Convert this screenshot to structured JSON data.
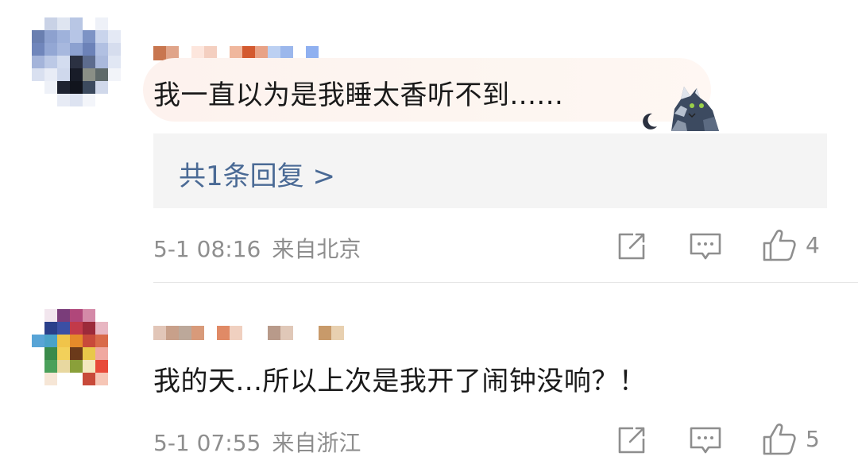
{
  "comments": [
    {
      "content": "我一直以为是我睡太香听不到......",
      "reply_label": "共1条回复 >",
      "date": "5-1 08:16",
      "location": "来自北京",
      "likes": "4",
      "icons": [
        "share-icon",
        "comment-icon",
        "like-icon"
      ]
    },
    {
      "content": "我的天...所以上次是我开了闹钟没响？！",
      "date": "5-1 07:55",
      "location": "来自浙江",
      "likes": "5",
      "icons": [
        "share-icon",
        "comment-icon",
        "like-icon"
      ]
    }
  ],
  "colors": {
    "text": "#1a1a1a",
    "meta": "#8e8e8e",
    "link": "#4a6a95",
    "reply_bg": "#f4f4f4",
    "divider": "#e6e6e6",
    "icon": "#8e8e8e"
  }
}
